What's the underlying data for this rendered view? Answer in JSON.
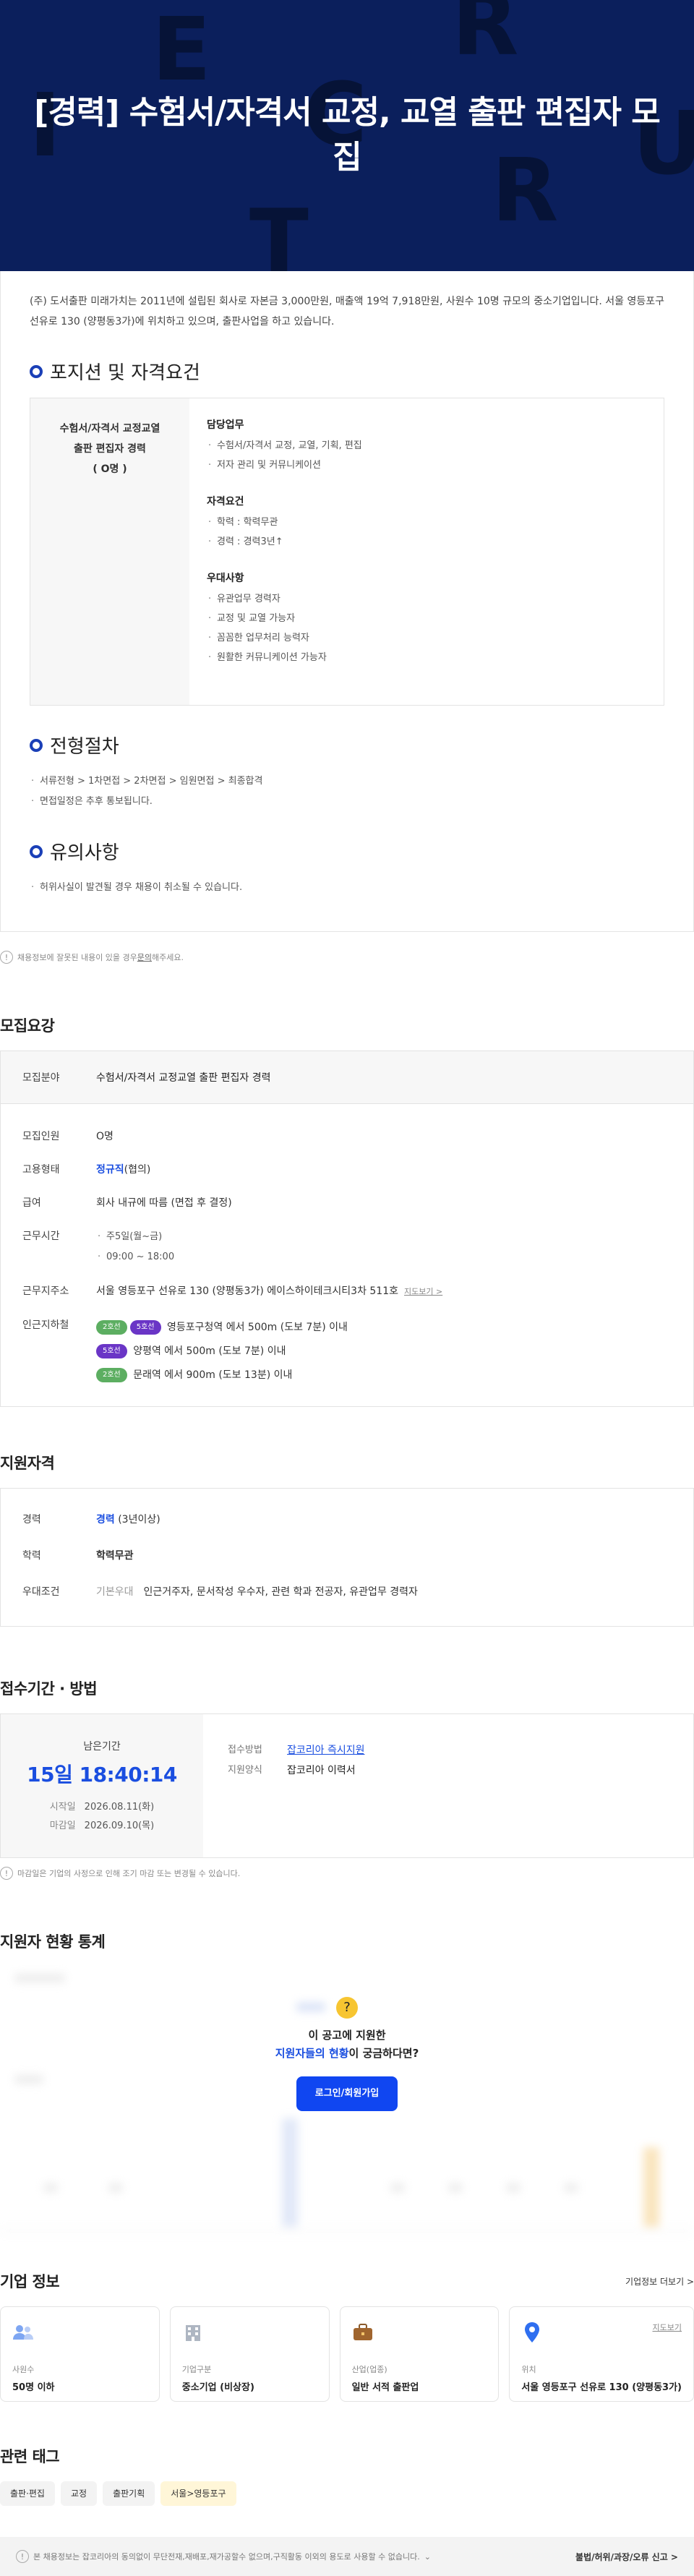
{
  "hero": {
    "title": "[경력] 수험서/자격서 교정, 교열 출판 편집자 모집",
    "deco_letters": [
      "E",
      "R",
      "C",
      "U",
      "R",
      "I",
      "T"
    ]
  },
  "intro": "(주) 도서출판 미래가치는 2011년에 설립된 회사로 자본금 3,000만원, 매출액 19억 7,918만원, 사원수 10명 규모의 중소기업입니다. 서울 영등포구 선유로 130 (양평동3가)에 위치하고 있으며, 출판사업을 하고 있습니다.",
  "position": {
    "section_title": "포지션 및 자격요건",
    "left_lines": [
      "수험서/자격서 교정교열",
      "출판 편집자 경력",
      "( O명 )"
    ],
    "groups": [
      {
        "title": "담당업무",
        "items": [
          "수험서/자격서 교정, 교열, 기획, 편집",
          "저자 관리 및 커뮤니케이션"
        ]
      },
      {
        "title": "자격요건",
        "items": [
          "학력 : 학력무관",
          "경력 : 경력3년↑"
        ]
      },
      {
        "title": "우대사항",
        "items": [
          "유관업무 경력자",
          "교정 및 교열 가능자",
          "꼼꼼한 업무처리 능력자",
          "원활한 커뮤니케이션 가능자"
        ]
      }
    ]
  },
  "process": {
    "section_title": "전형절차",
    "lines": [
      "서류전형 > 1차면접 > 2차면접 > 임원면접 > 최종합격",
      "면접일정은 추후 통보됩니다."
    ]
  },
  "caution": {
    "section_title": "유의사항",
    "lines": [
      "허위사실이 발견될 경우 채용이 취소될 수 있습니다."
    ]
  },
  "report_notice": {
    "before": "채용정보에 잘못된 내용이 있을 경우 ",
    "link": "문의",
    "after": "해주세요."
  },
  "requirements": {
    "title": "모집요강",
    "field_label": "모집분야",
    "field_value": "수험서/자격서 교정교열 출판 편집자 경력",
    "headcount_label": "모집인원",
    "headcount_value": "O명",
    "employment_label": "고용형태",
    "employment_value": "정규직",
    "employment_note": "(협의)",
    "salary_label": "급여",
    "salary_value": "회사 내규에 따름 (면접 후 결정)",
    "hours_label": "근무시간",
    "hours_lines": [
      "주5일(월~금)",
      "09:00 ~ 18:00"
    ],
    "address_label": "근무지주소",
    "address_value": "서울 영등포구 선유로 130 (양평동3가) 에이스하이테크시티3차 511호",
    "map_link": "지도보기 >",
    "station_label": "인근지하철",
    "stations": [
      {
        "badges": [
          {
            "text": "2호선",
            "color": "green"
          },
          {
            "text": "5호선",
            "color": "purple"
          }
        ],
        "text": "영등포구청역 에서 500m (도보 7분) 이내"
      },
      {
        "badges": [
          {
            "text": "5호선",
            "color": "purple"
          }
        ],
        "text": "양평역 에서 500m (도보 7분) 이내"
      },
      {
        "badges": [
          {
            "text": "2호선",
            "color": "green"
          }
        ],
        "text": "문래역 에서 900m (도보 13분) 이내"
      }
    ]
  },
  "qualification": {
    "title": "지원자격",
    "career_label": "경력",
    "career_value": "경력",
    "career_note": "(3년이상)",
    "edu_label": "학력",
    "edu_value": "학력무관",
    "pref_label": "우대조건",
    "pref_tag": "기본우대",
    "pref_value": "인근거주자, 문서작성 우수자, 관련 학과 전공자, 유관업무 경력자"
  },
  "period": {
    "title": "접수기간 · 방법",
    "remain_label": "남은기간",
    "remain_value": "15일 18:40:14",
    "start_label": "시작일",
    "start_value": "2026.08.11(화)",
    "end_label": "마감일",
    "end_value": "2026.09.10(목)",
    "method_label": "접수방법",
    "method_value": "잡코리아 즉시지원",
    "form_label": "지원양식",
    "form_value": "잡코리아 이력서",
    "notice": "마감일은 기업의 사정으로 인해 조기 마감 또는 변경될 수 있습니다."
  },
  "stats": {
    "title": "지원자 현황 통계",
    "overlay_line1": "이 공고에 지원한",
    "overlay_highlight": "지원자들의 현황",
    "overlay_line2_rest": "이 궁금하다면?",
    "button": "로그인/회원가입"
  },
  "company": {
    "title": "기업 정보",
    "more_link": "기업정보 더보기 >",
    "cards": [
      {
        "icon": "people-icon",
        "label": "사원수",
        "value": "50명 이하"
      },
      {
        "icon": "building-icon",
        "label": "기업구분",
        "value": "중소기업 (비상장)"
      },
      {
        "icon": "briefcase-icon",
        "label": "산업(업종)",
        "value": "일반 서적 출판업"
      },
      {
        "icon": "location-pin-icon",
        "label": "위치",
        "value": "서울 영등포구 선유로 130 (양평동3가)",
        "link": "지도보기"
      }
    ]
  },
  "tags": {
    "title": "관련 태그",
    "items": [
      "출판·편집",
      "교정",
      "출판기획",
      "서울>영등포구"
    ]
  },
  "bottom_bar": {
    "copyright": "본 채용정보는 잡코리아의 동의없이 무단전재,재배포,재가공할수 없으며,구직활동 이외의 용도로 사용할 수 없습니다.",
    "report": "불법/허위/과장/오류 신고 >"
  },
  "colors": {
    "hero_bg": "#0b1f5c",
    "accent": "#1a4ee0",
    "button": "#1046f1"
  }
}
